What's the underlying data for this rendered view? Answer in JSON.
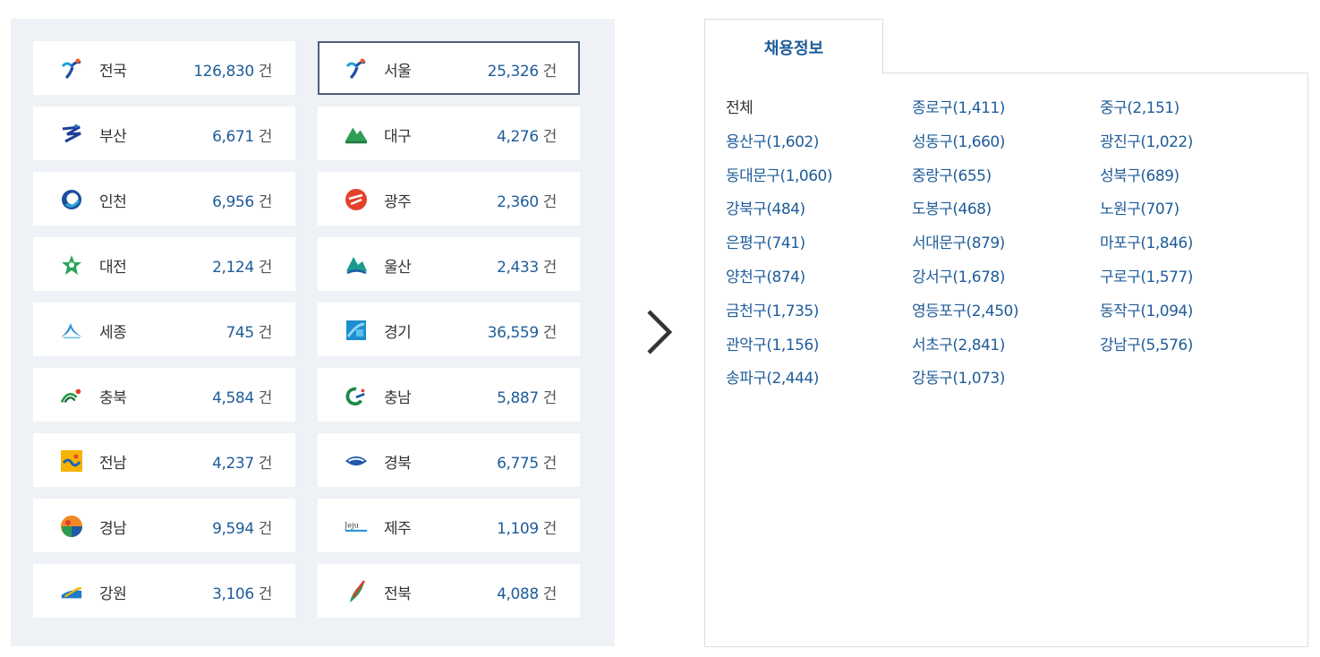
{
  "unit_label": "건",
  "regions": [
    {
      "name": "전국",
      "count": "126,830",
      "icon": "seoul-emblem-icon",
      "selected": false
    },
    {
      "name": "서울",
      "count": "25,326",
      "icon": "seoul-emblem-icon",
      "selected": true
    },
    {
      "name": "부산",
      "count": "6,671",
      "icon": "busan-emblem-icon",
      "selected": false
    },
    {
      "name": "대구",
      "count": "4,276",
      "icon": "daegu-emblem-icon",
      "selected": false
    },
    {
      "name": "인천",
      "count": "6,956",
      "icon": "incheon-emblem-icon",
      "selected": false
    },
    {
      "name": "광주",
      "count": "2,360",
      "icon": "gwangju-emblem-icon",
      "selected": false
    },
    {
      "name": "대전",
      "count": "2,124",
      "icon": "daejeon-emblem-icon",
      "selected": false
    },
    {
      "name": "울산",
      "count": "2,433",
      "icon": "ulsan-emblem-icon",
      "selected": false
    },
    {
      "name": "세종",
      "count": "745",
      "icon": "sejong-emblem-icon",
      "selected": false
    },
    {
      "name": "경기",
      "count": "36,559",
      "icon": "gyeonggi-emblem-icon",
      "selected": false
    },
    {
      "name": "충북",
      "count": "4,584",
      "icon": "chungbuk-emblem-icon",
      "selected": false
    },
    {
      "name": "충남",
      "count": "5,887",
      "icon": "chungnam-emblem-icon",
      "selected": false
    },
    {
      "name": "전남",
      "count": "4,237",
      "icon": "jeonnam-emblem-icon",
      "selected": false
    },
    {
      "name": "경북",
      "count": "6,775",
      "icon": "gyeongbuk-emblem-icon",
      "selected": false
    },
    {
      "name": "경남",
      "count": "9,594",
      "icon": "gyeongnam-emblem-icon",
      "selected": false
    },
    {
      "name": "제주",
      "count": "1,109",
      "icon": "jeju-emblem-icon",
      "selected": false
    },
    {
      "name": "강원",
      "count": "3,106",
      "icon": "gangwon-emblem-icon",
      "selected": false
    },
    {
      "name": "전북",
      "count": "4,088",
      "icon": "jeonbuk-emblem-icon",
      "selected": false
    }
  ],
  "tab": {
    "label": "채용정보"
  },
  "districts": [
    "전체",
    "종로구(1,411)",
    "중구(2,151)",
    "용산구(1,602)",
    "성동구(1,660)",
    "광진구(1,022)",
    "동대문구(1,060)",
    "중랑구(655)",
    "성북구(689)",
    "강북구(484)",
    "도봉구(468)",
    "노원구(707)",
    "은평구(741)",
    "서대문구(879)",
    "마포구(1,846)",
    "양천구(874)",
    "강서구(1,678)",
    "구로구(1,577)",
    "금천구(1,735)",
    "영등포구(2,450)",
    "동작구(1,094)",
    "관악구(1,156)",
    "서초구(2,841)",
    "강남구(5,576)",
    "송파구(2,444)",
    "강동구(1,073)"
  ],
  "colors": {
    "accent": "#1f5c99",
    "panel_bg": "#eef2f6",
    "selected_border": "#4b5f78"
  }
}
